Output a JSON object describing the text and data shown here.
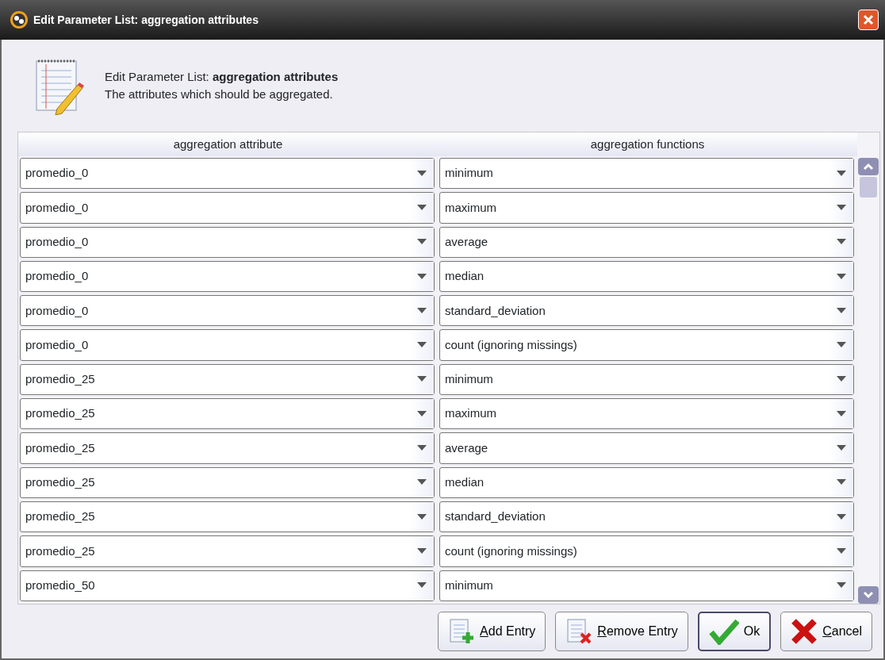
{
  "window": {
    "title": "Edit Parameter List: aggregation attributes"
  },
  "header": {
    "title": "Edit Parameter List: **aggregation attributes**",
    "description": "The attributes which should be aggregated."
  },
  "table": {
    "columns": [
      "aggregation attribute",
      "aggregation functions"
    ],
    "rows": [
      {
        "attribute": "promedio_0",
        "function": "minimum"
      },
      {
        "attribute": "promedio_0",
        "function": "maximum"
      },
      {
        "attribute": "promedio_0",
        "function": "average"
      },
      {
        "attribute": "promedio_0",
        "function": "median"
      },
      {
        "attribute": "promedio_0",
        "function": "standard_deviation"
      },
      {
        "attribute": "promedio_0",
        "function": "count (ignoring missings)"
      },
      {
        "attribute": "promedio_25",
        "function": "minimum"
      },
      {
        "attribute": "promedio_25",
        "function": "maximum"
      },
      {
        "attribute": "promedio_25",
        "function": "average"
      },
      {
        "attribute": "promedio_25",
        "function": "median"
      },
      {
        "attribute": "promedio_25",
        "function": "standard_deviation"
      },
      {
        "attribute": "promedio_25",
        "function": "count (ignoring missings)"
      },
      {
        "attribute": "promedio_50",
        "function": "minimum"
      }
    ]
  },
  "buttons": [
    {
      "label": "Add Entry",
      "kind": "add",
      "mnemonic": true,
      "focused": false
    },
    {
      "label": "Remove Entry",
      "kind": "remove",
      "mnemonic": true,
      "focused": false
    },
    {
      "label": "Ok",
      "kind": "ok",
      "mnemonic": false,
      "focused": true
    },
    {
      "label": "Cancel",
      "kind": "cancel",
      "mnemonic": true,
      "focused": false
    }
  ]
}
